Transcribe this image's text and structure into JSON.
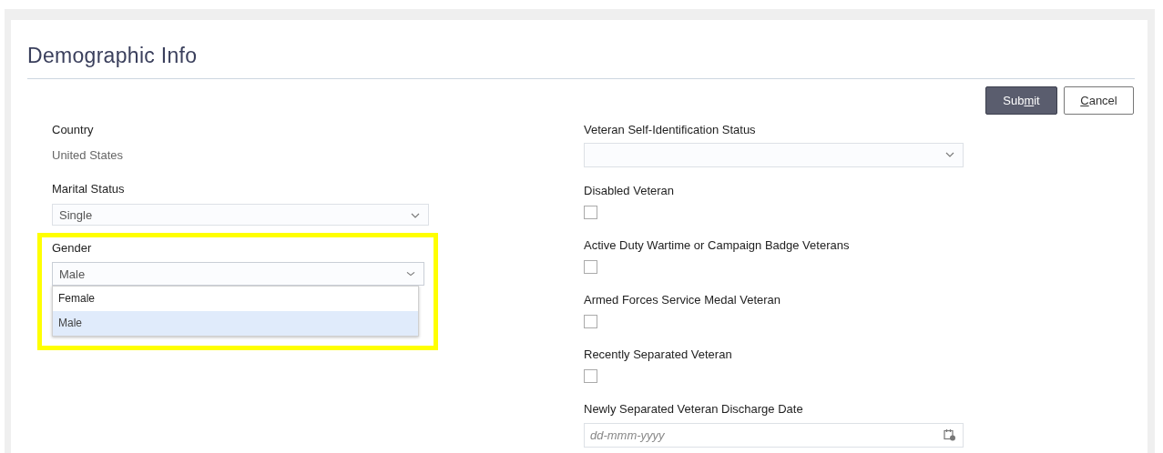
{
  "title": "Demographic Info",
  "buttons": [
    {
      "kind": "primary",
      "label_start": "Sub",
      "access_key": "m",
      "label_end": "it"
    },
    {
      "kind": "secondary",
      "access_key": "C",
      "label_end": "ancel"
    }
  ],
  "left_fields": [
    {
      "kind": "text",
      "label": "Country",
      "value": "United States"
    },
    {
      "kind": "select",
      "label": "Marital Status",
      "value": "Single"
    },
    {
      "kind": "select",
      "label": "Gender",
      "value": "Male",
      "highlighted": true,
      "expanded": true,
      "options": [
        {
          "label": "Female",
          "selected": false
        },
        {
          "label": "Male",
          "selected": true
        }
      ]
    }
  ],
  "right_fields": [
    {
      "kind": "select",
      "label": "Veteran Self-Identification Status"
    },
    {
      "kind": "checkbox",
      "label": "Disabled Veteran",
      "checked": false
    },
    {
      "kind": "checkbox",
      "label": "Active Duty Wartime or Campaign Badge Veterans",
      "checked": false
    },
    {
      "kind": "checkbox",
      "label": "Armed Forces Service Medal Veteran",
      "checked": false
    },
    {
      "kind": "checkbox",
      "label": "Recently Separated Veteran",
      "checked": false
    },
    {
      "kind": "date",
      "label": "Newly Separated Veteran Discharge Date",
      "placeholder": "dd-mmm-yyyy"
    }
  ]
}
